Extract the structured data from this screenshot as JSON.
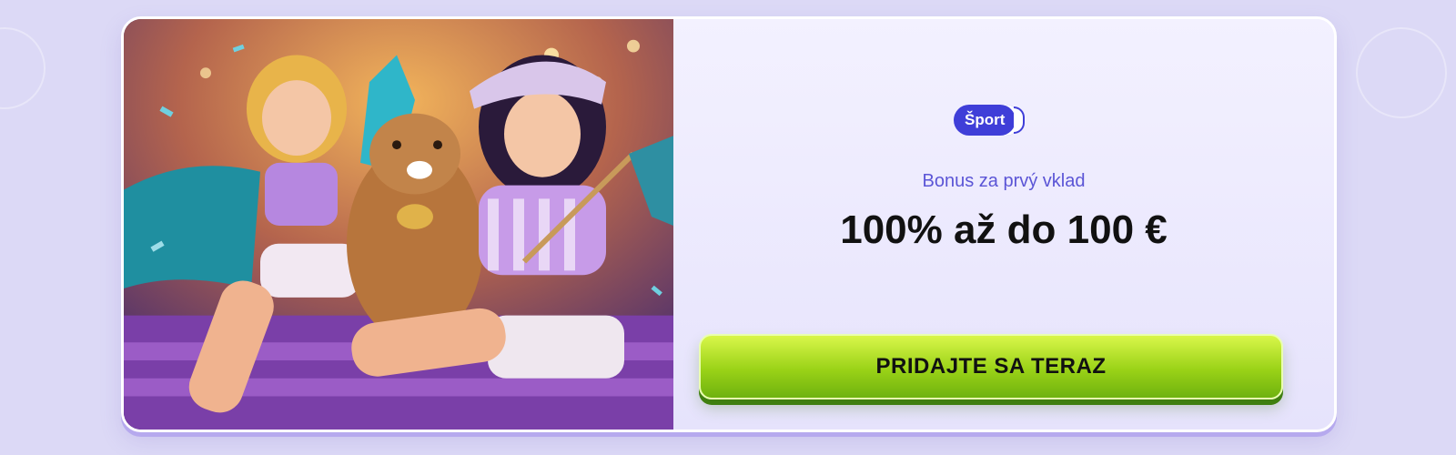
{
  "promo": {
    "tag_label": "Šport",
    "subtitle": "Bonus za prvý vklad",
    "headline": "100% až do 100 €",
    "cta_label": "PRIDAJTE SA TERAZ"
  },
  "colors": {
    "page_background": "#dcd9f6",
    "card_background": "#f0eeff",
    "tag": "#3f3ed8",
    "subtitle": "#5b55d6",
    "cta_green": "#9ad217"
  }
}
